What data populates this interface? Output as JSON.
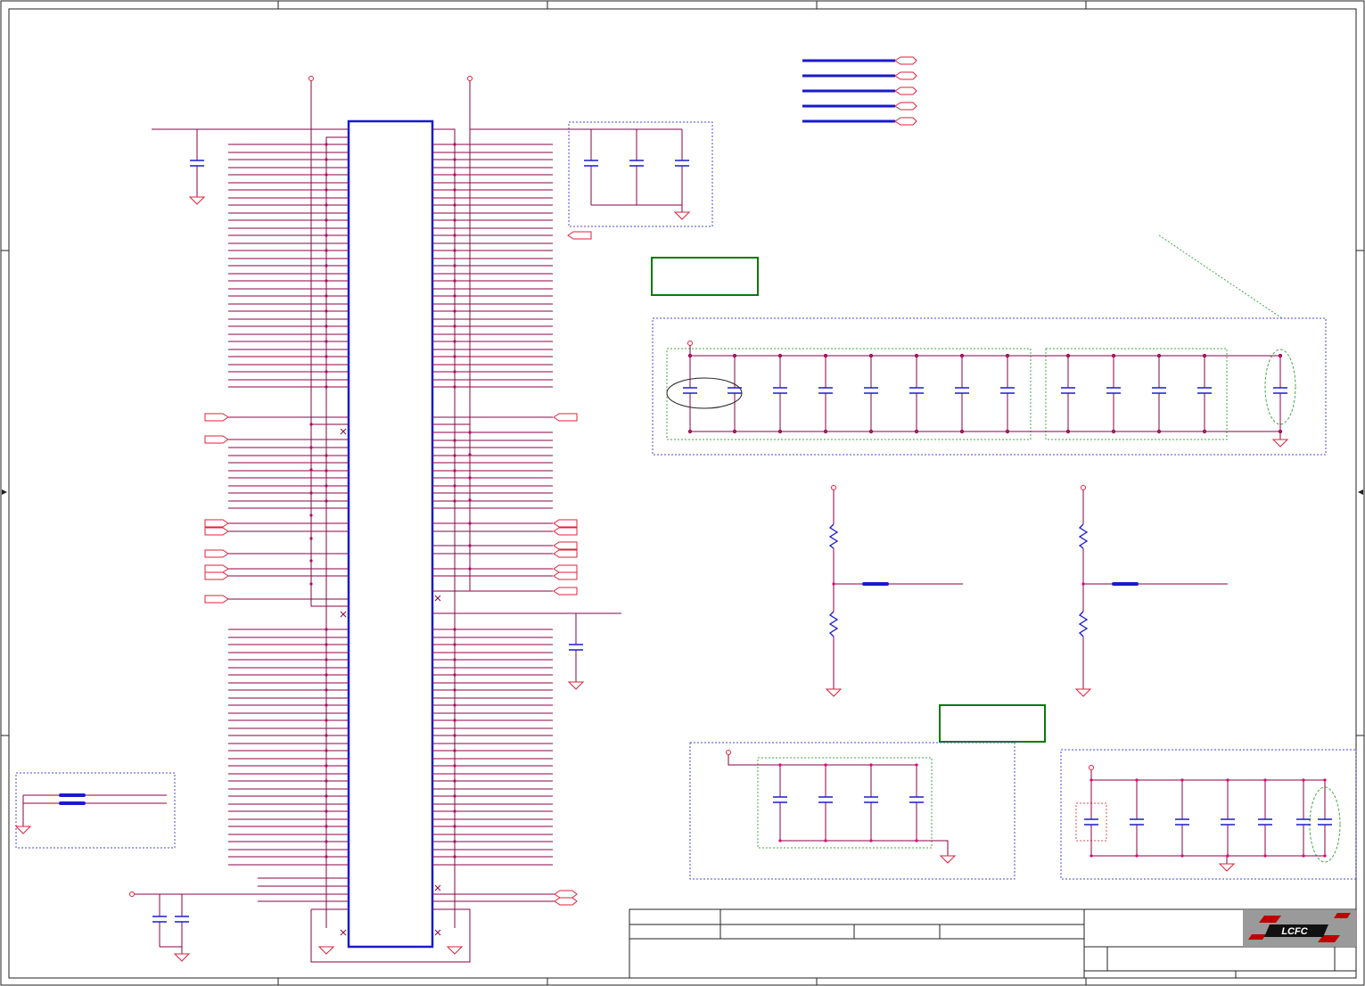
{
  "title_block": {
    "logo_text": "LCFC",
    "fields": [
      "",
      "",
      "",
      "",
      "",
      "",
      ""
    ]
  },
  "colors": {
    "net": "#8b0045",
    "pin": "#e0007a",
    "component": "#1a1acc",
    "power": "#e0203a",
    "frame": "#222222",
    "note_box": "#0a7a0a",
    "group_box": "#4a4ad8",
    "sub_group_box": "#44aa44"
  },
  "icons": [
    "ground-symbol-icon",
    "power-port-icon",
    "off-page-connector-icon",
    "capacitor-icon",
    "resistor-icon",
    "no-connect-icon"
  ]
}
